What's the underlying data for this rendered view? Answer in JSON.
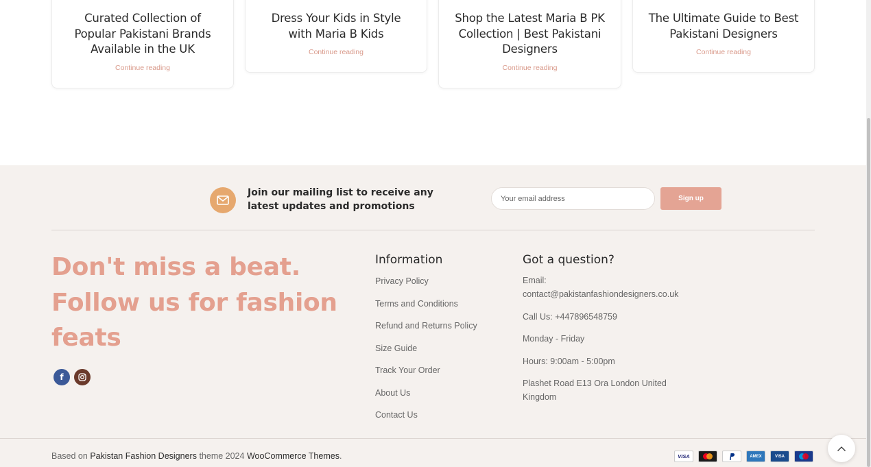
{
  "posts": [
    {
      "title": "Curated Collection of Popular Pakistani Brands Available in the UK",
      "link": "Continue reading"
    },
    {
      "title": "Dress Your Kids in Style with Maria B Kids",
      "link": "Continue reading"
    },
    {
      "title": "Shop the Latest Maria B PK Collection | Best Pakistani Designers",
      "link": "Continue reading"
    },
    {
      "title": "The Ultimate Guide to Best Pakistani Designers",
      "link": "Continue reading"
    }
  ],
  "newsletter": {
    "text": "Join our mailing list to receive any latest updates and promotions",
    "placeholder": "Your email address",
    "button": "Sign up",
    "icon": "envelope-icon"
  },
  "footer": {
    "tagline": "Don't miss a beat. Follow us for fashion feats",
    "socials": [
      {
        "name": "facebook-icon",
        "glyph": "f"
      },
      {
        "name": "instagram-icon"
      }
    ],
    "information": {
      "title": "Information",
      "links": [
        "Privacy Policy",
        "Terms and Conditions",
        "Refund and Returns Policy",
        "Size Guide",
        "Track Your Order",
        "About Us",
        "Contact Us"
      ]
    },
    "contact": {
      "title": "Got a question?",
      "email": "Email: contact@pakistanfashiondesigners.co.uk",
      "phone": "Call Us: +447896548759",
      "days": "Monday - Friday",
      "hours": "Hours: 9:00am - 5:00pm",
      "address": "Plashet Road E13 Ora London United Kingdom"
    },
    "copyright": {
      "prefix": "Based on",
      "site": "Pakistan Fashion Designers",
      "middle": "theme 2024",
      "theme": "WooCommerce Themes",
      "suffix": "."
    },
    "payments": [
      {
        "name": "visa-icon",
        "label": "VISA"
      },
      {
        "name": "mastercard-icon",
        "label": ""
      },
      {
        "name": "paypal-icon",
        "label": "PayPal"
      },
      {
        "name": "amex-icon",
        "label": "AMEX"
      },
      {
        "name": "visa-electron-icon",
        "label": "VISA"
      },
      {
        "name": "maestro-icon",
        "label": ""
      }
    ]
  },
  "colors": {
    "accent": "#e4a08f",
    "footer_bg": "#f5f1ee",
    "button": "#e4a494",
    "mail_icon": "#e6a86e"
  }
}
